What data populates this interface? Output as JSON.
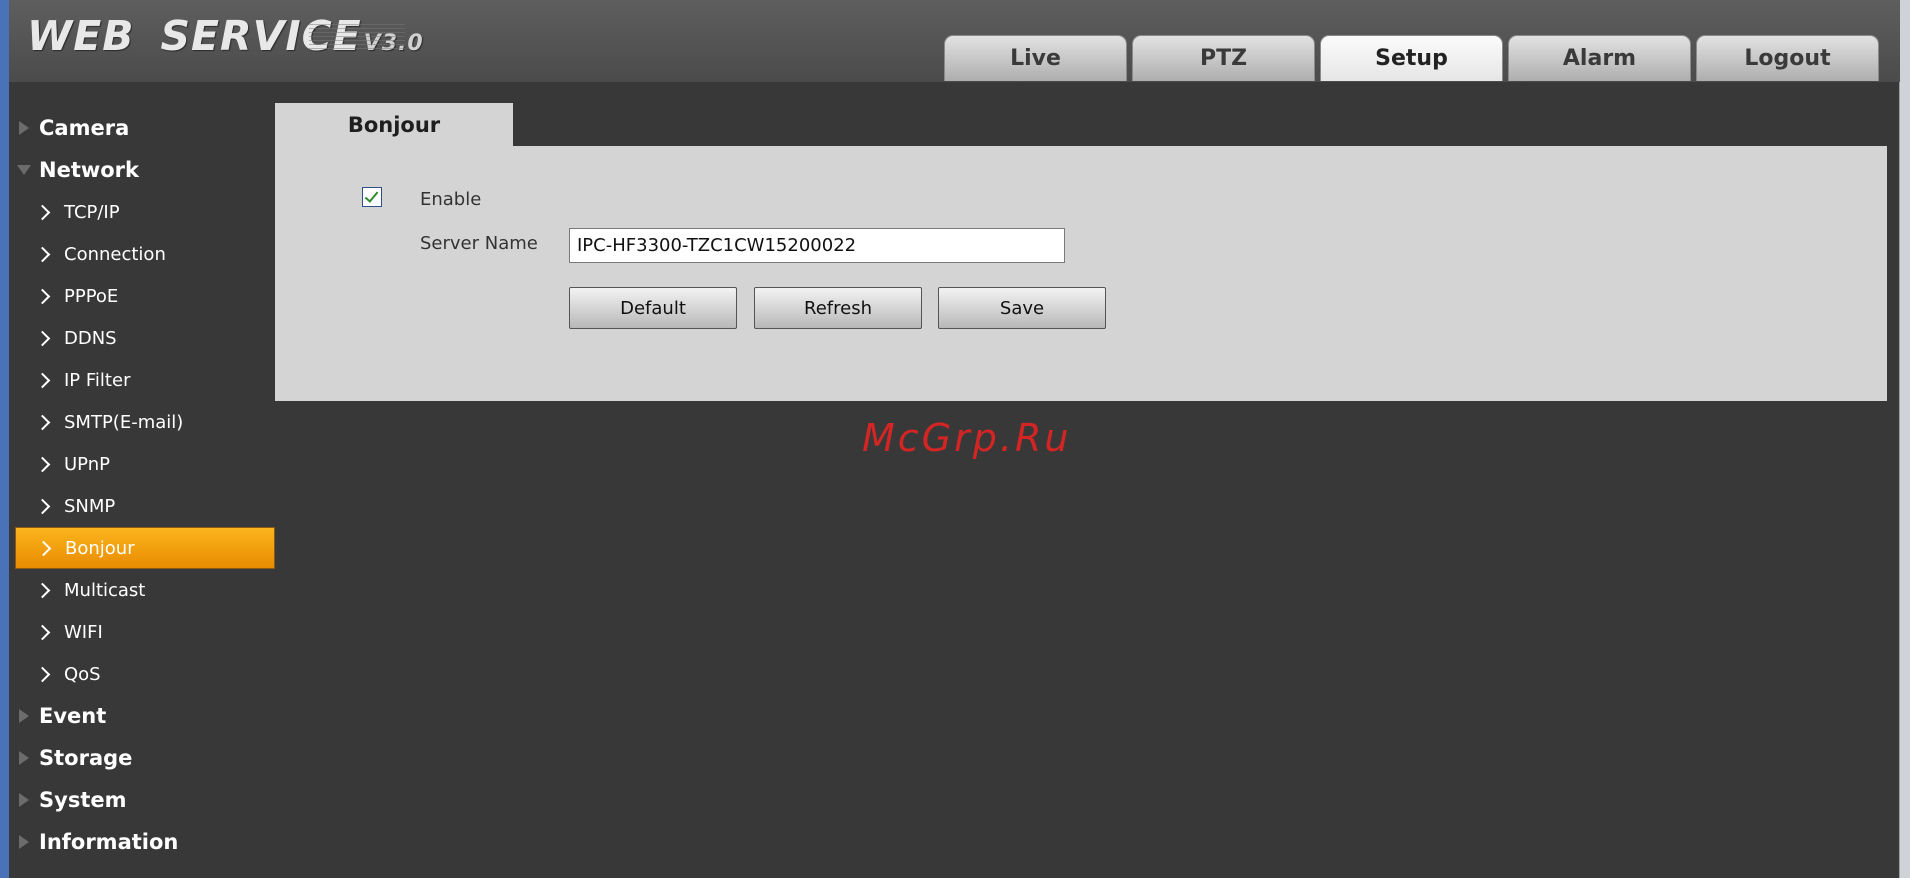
{
  "header": {
    "logo_text_1": "WEB",
    "logo_text_2": "SERVICE",
    "logo_version": "V3.0",
    "tabs": [
      {
        "label": "Live"
      },
      {
        "label": "PTZ"
      },
      {
        "label": "Setup",
        "active": true
      },
      {
        "label": "Alarm"
      },
      {
        "label": "Logout"
      }
    ]
  },
  "sidebar": {
    "items": [
      {
        "label": "Camera",
        "type": "group",
        "expanded": false
      },
      {
        "label": "Network",
        "type": "group",
        "expanded": true
      },
      {
        "label": "TCP/IP",
        "type": "sub"
      },
      {
        "label": "Connection",
        "type": "sub"
      },
      {
        "label": "PPPoE",
        "type": "sub"
      },
      {
        "label": "DDNS",
        "type": "sub"
      },
      {
        "label": "IP Filter",
        "type": "sub"
      },
      {
        "label": "SMTP(E-mail)",
        "type": "sub"
      },
      {
        "label": "UPnP",
        "type": "sub"
      },
      {
        "label": "SNMP",
        "type": "sub"
      },
      {
        "label": "Bonjour",
        "type": "sub",
        "active": true
      },
      {
        "label": "Multicast",
        "type": "sub"
      },
      {
        "label": "WIFI",
        "type": "sub"
      },
      {
        "label": "QoS",
        "type": "sub"
      },
      {
        "label": "Event",
        "type": "group",
        "expanded": false
      },
      {
        "label": "Storage",
        "type": "group",
        "expanded": false
      },
      {
        "label": "System",
        "type": "group",
        "expanded": false
      },
      {
        "label": "Information",
        "type": "group",
        "expanded": false
      }
    ]
  },
  "main": {
    "panel_title": "Bonjour",
    "enable_label": "Enable",
    "enable_checked": true,
    "server_name_label": "Server Name",
    "server_name_value": "IPC-HF3300-TZC1CW15200022",
    "buttons": {
      "default": "Default",
      "refresh": "Refresh",
      "save": "Save"
    }
  },
  "watermark": "McGrp.Ru",
  "colors": {
    "background": "#383838",
    "panel": "#d4d4d4",
    "active_item": "#f5a00f",
    "watermark": "#d42525"
  }
}
